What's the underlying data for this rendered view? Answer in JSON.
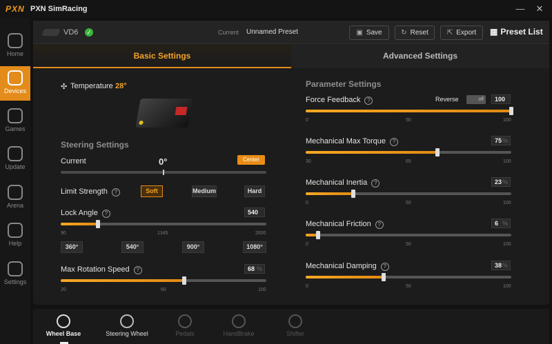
{
  "app": {
    "logo": "PXN",
    "title": "PXN SimRacing",
    "minimize": "—",
    "close": "✕"
  },
  "sidebar": {
    "items": [
      {
        "label": "Home",
        "icon": "home-icon"
      },
      {
        "label": "Devices",
        "icon": "devices-icon",
        "active": true
      },
      {
        "label": "Games",
        "icon": "gamepad-icon"
      },
      {
        "label": "Update",
        "icon": "update-icon"
      },
      {
        "label": "Arena",
        "icon": "arena-icon"
      },
      {
        "label": "Help",
        "icon": "help-icon"
      },
      {
        "label": "Settings",
        "icon": "gear-icon"
      }
    ]
  },
  "toolbar": {
    "device": "VD6",
    "device_status": "✓",
    "current_label": "Current",
    "current_preset": "Unnamed Preset",
    "save": "Save",
    "reset": "Reset",
    "export": "Export",
    "preset_list": "Preset List"
  },
  "tabs": {
    "basic": "Basic Settings",
    "advanced": "Advanced Settings"
  },
  "left": {
    "temperature_label": "Temperature",
    "temperature_value": "28°",
    "steering_title": "Steering Settings",
    "current_label": "Current",
    "current_value": "0°",
    "center_btn": "Center",
    "limit_label": "Limit Strength",
    "limit_options": [
      "Soft",
      "Medium",
      "Hard"
    ],
    "limit_selected": "Soft",
    "lock_label": "Lock Angle",
    "lock_value": "540",
    "lock_min": "90",
    "lock_mid": "1345",
    "lock_max": "2600",
    "lock_fraction": 0.18,
    "lock_presets": [
      "360°",
      "540°",
      "900°",
      "1080°"
    ],
    "rot_label": "Max Rotation Speed",
    "rot_value": "68",
    "rot_unit": "%",
    "rot_min": "20",
    "rot_mid": "60",
    "rot_max": "100",
    "rot_fraction": 0.6
  },
  "right": {
    "title": "Parameter Settings",
    "reverse_label": "Reverse",
    "reverse_state": "off",
    "params": [
      {
        "label": "Force Feedback",
        "value": "100",
        "min": "0",
        "mid": "50",
        "max": "100",
        "fraction": 1.0
      },
      {
        "label": "Mechanical Max Torque",
        "value": "75",
        "min": "30",
        "mid": "65",
        "max": "100",
        "fraction": 0.64
      },
      {
        "label": "Mechanical Inertia",
        "value": "23",
        "min": "0",
        "mid": "50",
        "max": "100",
        "fraction": 0.23
      },
      {
        "label": "Mechanical Friction",
        "value": "6",
        "min": "0",
        "mid": "50",
        "max": "100",
        "fraction": 0.06
      },
      {
        "label": "Mechanical Damping",
        "value": "38",
        "min": "0",
        "mid": "50",
        "max": "100",
        "fraction": 0.38
      }
    ],
    "unit": "%"
  },
  "bottom": {
    "tabs": [
      "Wheel Base",
      "Steering Wheel",
      "Pedals",
      "HandBrake",
      "Shifter"
    ]
  }
}
